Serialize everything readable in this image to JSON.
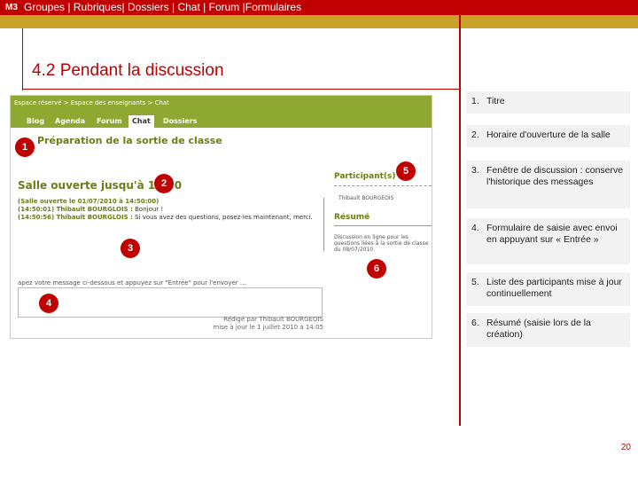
{
  "header": {
    "badge": "M3",
    "nav": [
      "Groupes",
      "Rubriques",
      "Dossiers",
      "Chat",
      "Forum",
      "Formulaires"
    ],
    "separators": [
      " | ",
      "| ",
      " | ",
      " | ",
      " |"
    ]
  },
  "slide": {
    "title": "4.2 Pendant la discussion",
    "page": "20"
  },
  "screenshot": {
    "breadcrumb": "Espace réservé > Espace des enseignants > Chat",
    "tabs": [
      "Blog",
      "Agenda",
      "Forum",
      "Chat",
      "Dossiers"
    ],
    "active_tab": "Chat",
    "chat_title": "Préparation de la sortie de classe",
    "open_until": "Salle ouverte jusqu'à 15:30",
    "history_header": "(Salle ouverte le 01/07/2010 à 14:50:00)",
    "messages": [
      {
        "time": "(14:50:01) Thibault BOURGLOIS :",
        "text": "Bonjour !"
      },
      {
        "time": "(14:50:56) Thibault BOURGLOIS :",
        "text": "Si vous avez des questions, posez-les maintenant, merci."
      }
    ],
    "input_placeholder": "apez votre message ci-dessous et appuyez sur \"Entrée\" pour l'envoyer ...",
    "credit_line1": "Rédigé par Thibault BOURGEOIS",
    "credit_line2": "mise à jour le 1 juillet 2010 à 14:05",
    "participants_title": "Participant(s)",
    "participant_name": "Thibault BOURGEOIS",
    "summary_title": "Résumé",
    "summary_text": "Discussion en ligne pour les questions liées à la sortie de classe du 08/07/2010"
  },
  "badges": [
    "1",
    "2",
    "3",
    "4",
    "5",
    "6"
  ],
  "legend": [
    {
      "num": "1.",
      "text": "Titre"
    },
    {
      "num": "2.",
      "text": "Horaire d'ouverture de la salle"
    },
    {
      "num": "3.",
      "text": "Fenêtre de discussion : conserve l'historique des messages"
    },
    {
      "num": "4.",
      "text": "Formulaire de saisie avec envoi en appuyant sur « Entrée »"
    },
    {
      "num": "5.",
      "text": "Liste des participants mise à jour continuellement"
    },
    {
      "num": "6.",
      "text": "Résumé (saisie lors de la création)"
    }
  ],
  "colors": {
    "accent": "#c00000",
    "gold": "#c9a227",
    "app_green": "#8ea832"
  }
}
